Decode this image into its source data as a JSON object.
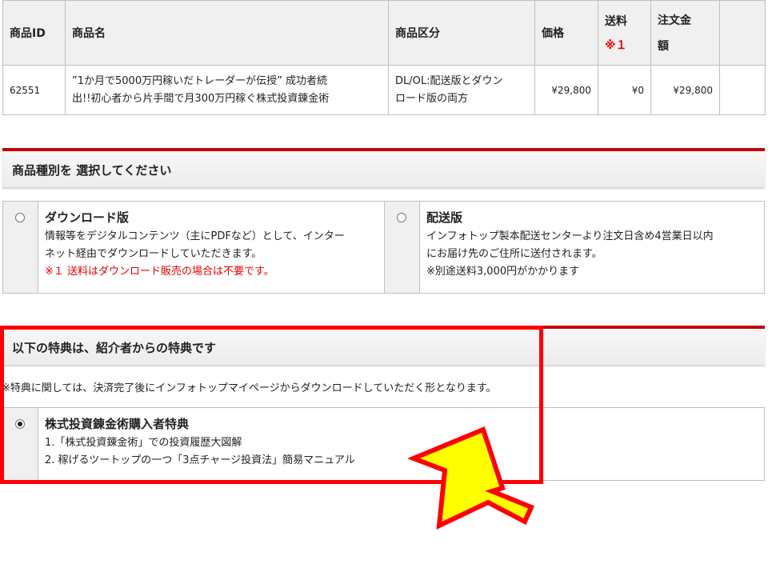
{
  "table": {
    "headers": {
      "id": "商品ID",
      "name": "商品名",
      "category": "商品区分",
      "price": "価格",
      "shipping": "送料",
      "shipping_note": "※１",
      "total_line1": "注文金",
      "total_line2": "額"
    },
    "row": {
      "id": "62551",
      "name_line1": "”1か月で5000万円稼いだトレーダーが伝授” 成功者続",
      "name_line2": "出!!初心者から片手間で月300万円稼ぐ株式投資錬金術",
      "category_line1": "DL/OL:配送版とダウン",
      "category_line2": "ロード版の両方",
      "price": "¥29,800",
      "shipping": "¥0",
      "total": "¥29,800"
    }
  },
  "product_type": {
    "heading": "商品種別を 選択してください",
    "download": {
      "title": "ダウンロード版",
      "line1": "情報等をデジタルコンテンツ（主にPDFなど）として、インター",
      "line2": "ネット経由でダウンロードしていただきます。",
      "note": "※１ 送料はダウンロード販売の場合は不要です。"
    },
    "delivery": {
      "title": "配送版",
      "line1": "インフォトップ製本配送センターより注文日含め4営業日以内",
      "line2": "にお届け先のご住所に送付されます。",
      "line3": "※別途送料3,000円がかかります"
    }
  },
  "bonus": {
    "heading": "以下の特典は、紹介者からの特典です",
    "note": "※特典に関しては、決済完了後にインフォトップマイページからダウンロードしていただく形となります。",
    "option": {
      "title": "株式投資錬金術購入者特典",
      "item1": "1.「株式投資錬金術」での投資履歴大図解",
      "item2": "2. 稼げるツートップの一つ「3点チャージ投資法」簡易マニュアル"
    }
  },
  "colors": {
    "accent_red": "#c40000",
    "highlight_red": "#ff0000",
    "arrow_yellow": "#ffff00"
  }
}
